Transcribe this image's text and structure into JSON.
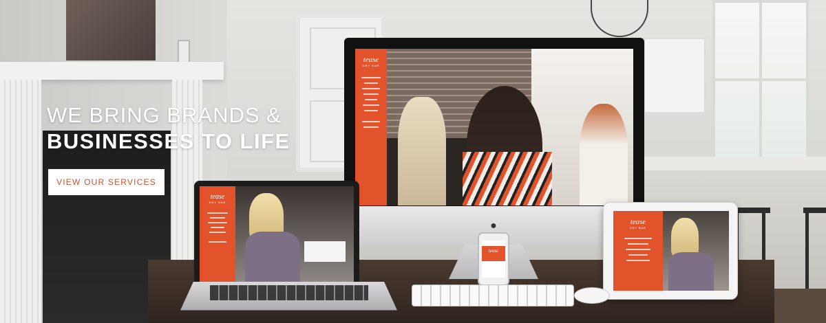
{
  "hero": {
    "headline_line1": "WE BRING BRANDS &",
    "headline_line2": "BUSINESSES TO LIFE",
    "cta_label": "VIEW OUR SERVICES"
  },
  "mockup_site": {
    "logo": "tease",
    "tagline": "DRY BAR"
  },
  "colors": {
    "accent": "#e2532b",
    "cta_text": "#c9512d",
    "headline": "#ffffff"
  }
}
